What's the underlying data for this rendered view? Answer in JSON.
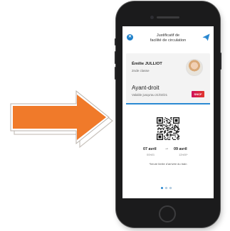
{
  "colors": {
    "arrow_orange": "#f07a2a",
    "accent_blue": "#2b8ad3",
    "phone_body": "#1b1b1c",
    "sncf_logo": "#d0105a"
  },
  "icons": {
    "close": "close-icon",
    "send": "send-paper-plane-icon",
    "arrow": "right-arrow-icon"
  },
  "header": {
    "close_glyph": "✕",
    "title_line1": "Justificatif de",
    "title_line2": "facilité de circulation"
  },
  "card": {
    "user_name": "Émilie JULLIOT",
    "user_class": "2nde classe",
    "role": "Ayant-droit",
    "validity": "Valable jusqu'au 21/02/21",
    "logo_text": "SNCF"
  },
  "trip": {
    "date_from": "07 avril",
    "arrow": "→",
    "date_to": "09 avril",
    "time_from": "00h01",
    "time_to": "12h00*",
    "footnote": "*heure limite d'arrivée du train"
  },
  "pager": {
    "count": 3,
    "active_index": 0
  }
}
